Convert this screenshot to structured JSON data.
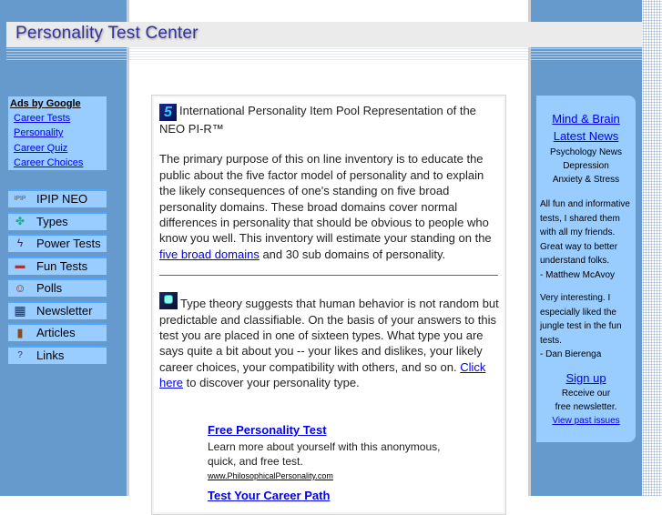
{
  "header": {
    "title": "Personality Test Center"
  },
  "ads": {
    "title": "Ads by Google",
    "links": [
      "Career Tests",
      "Personality",
      "Career Quiz",
      "Career Choices"
    ]
  },
  "nav": {
    "items": [
      {
        "label": "IPIP NEO",
        "icon": "ipip-icon",
        "glyph": "IPIP"
      },
      {
        "label": "Types",
        "icon": "types-icon",
        "glyph": "✤"
      },
      {
        "label": "Power Tests",
        "icon": "lightning-icon",
        "glyph": "ϟ"
      },
      {
        "label": "Fun Tests",
        "icon": "fun-tests-icon",
        "glyph": "▬"
      },
      {
        "label": "Polls",
        "icon": "people-icon",
        "glyph": "☺"
      },
      {
        "label": "Newsletter",
        "icon": "grid-icon",
        "glyph": "▦"
      },
      {
        "label": "Articles",
        "icon": "articles-icon",
        "glyph": "▮"
      },
      {
        "label": "Links",
        "icon": "question-icon",
        "glyph": "?"
      }
    ]
  },
  "main": {
    "ipip_title": "International Personality Item Pool Representation of the NEO PI-R™",
    "ipip_badge": "5",
    "ipip_body_before": "The primary purpose of this on line inventory is to educate the public about the five factor model of personality and to explain the likely consequences of one's standing on five broad personality domains. These broad domains cover normal differences in personality that should be obvious to people who know you well. This inventory will estimate your standing on the ",
    "ipip_link": "five broad domains",
    "ipip_body_after": " and 30 sub domains of personality.",
    "types_body": "Type theory suggests that human behavior is not random but predictable and classifiable. On the basis of your answers to this test you are placed in one of sixteen types. What type you are says quite a bit about you -- your likes and dislikes, your likely career choices, your compatibility with others, and so on.",
    "types_link": "Click here",
    "types_after": " to discover your personality type.",
    "ad_units": [
      {
        "title": "Free Personality Test",
        "line1": "Learn more about yourself with this anonymous,",
        "line2": "quick, and free test.",
        "url": "www.PhilosophicalPersonality.com"
      },
      {
        "title": "Test Your Career Path"
      }
    ]
  },
  "right": {
    "news_title1": "Mind & Brain",
    "news_title2": "Latest News",
    "news_items": [
      "Psychology News",
      "Depression",
      "Anxiety & Stress"
    ],
    "quotes": [
      {
        "lines": [
          "All fun and informative",
          "tests, I shared them",
          "with all my friends.",
          "Great way to better",
          "understand folks."
        ],
        "author": "- Matthew McAvoy"
      },
      {
        "lines": [
          "Very interesting. I",
          "especially liked the",
          "jungle test in the fun",
          "tests."
        ],
        "author": "- Dan Bierenga"
      }
    ],
    "signup": "Sign up",
    "signup_text1": "Receive our",
    "signup_text2": "free newsletter.",
    "past_issues": "View past issues"
  }
}
